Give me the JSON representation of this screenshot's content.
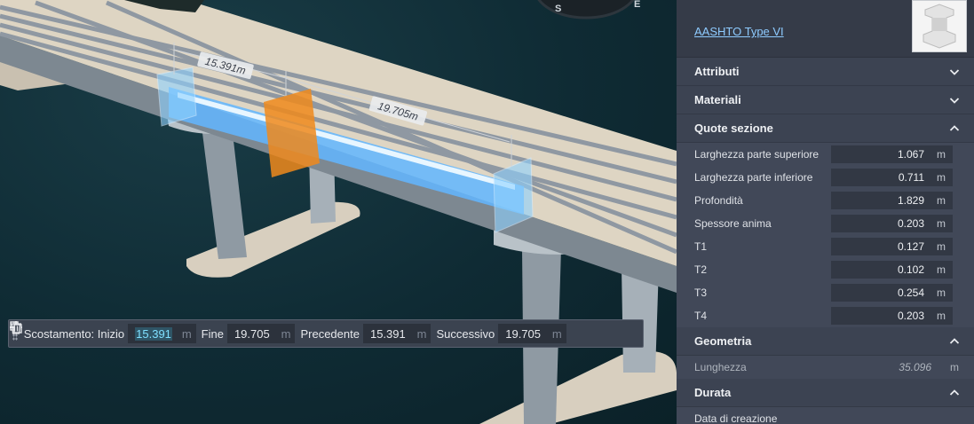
{
  "viewport": {
    "dimension_labels": [
      "15.391m",
      "19.705m"
    ],
    "compass_letters": [
      "S",
      "E"
    ]
  },
  "toolbar": {
    "label_start": "Scostamento: Inizio",
    "start_value": "15.391",
    "label_end": "Fine",
    "end_value": "19.705",
    "label_prev": "Precedente",
    "prev_value": "15.391",
    "label_next": "Successivo",
    "next_value": "19.705",
    "unit": "m",
    "add_icon": "plus-icon",
    "copy_icon": "copy-icon",
    "delete_icon": "trash-icon"
  },
  "panel": {
    "type_link": "AASHTO Type VI",
    "sections": {
      "attributi": "Attributi",
      "materiali": "Materiali",
      "quote": "Quote sezione",
      "geometria": "Geometria",
      "durata": "Durata"
    },
    "quote_rows": [
      {
        "label": "Larghezza parte superiore",
        "value": "1.067",
        "unit": "m"
      },
      {
        "label": "Larghezza parte inferiore",
        "value": "0.711",
        "unit": "m"
      },
      {
        "label": "Profondità",
        "value": "1.829",
        "unit": "m"
      },
      {
        "label": "Spessore anima",
        "value": "0.203",
        "unit": "m"
      },
      {
        "label": "T1",
        "value": "0.127",
        "unit": "m"
      },
      {
        "label": "T2",
        "value": "0.102",
        "unit": "m"
      },
      {
        "label": "T3",
        "value": "0.254",
        "unit": "m"
      },
      {
        "label": "T4",
        "value": "0.203",
        "unit": "m"
      }
    ],
    "geometria": {
      "label": "Lunghezza",
      "value": "35.096",
      "unit": "m"
    },
    "durata": {
      "label": "Data di creazione"
    }
  },
  "colors": {
    "panel_bg": "#3c4352",
    "link": "#8ecbff",
    "selection_blue": "#5fb4ff",
    "selection_orange": "#f08a1c"
  }
}
